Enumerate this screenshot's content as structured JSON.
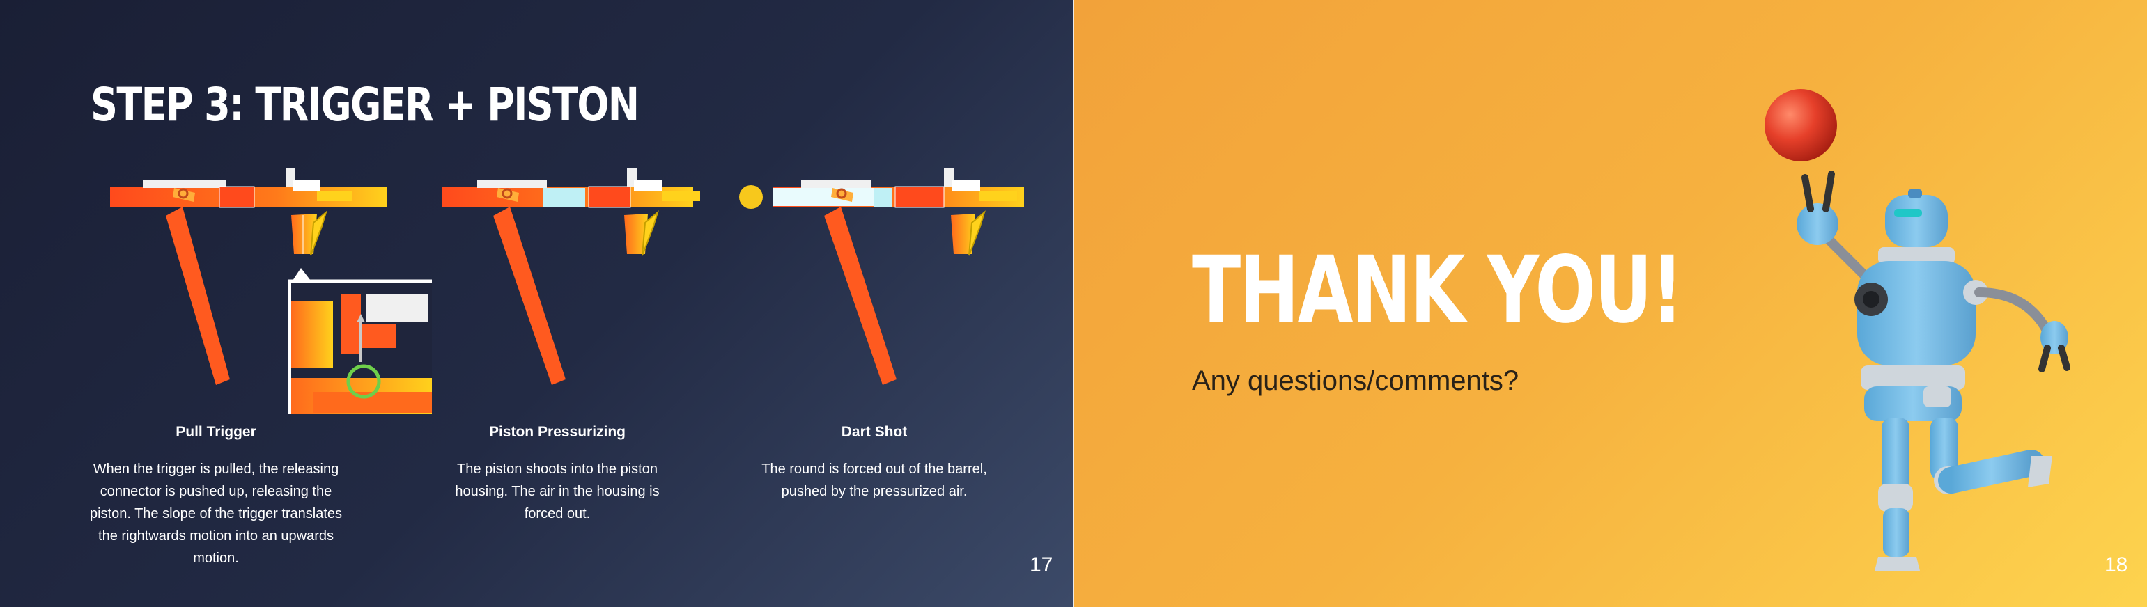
{
  "slides": [
    {
      "title": "STEP 3: TRIGGER + PISTON",
      "steps": [
        {
          "label": "Pull Trigger",
          "description": "When the trigger is pulled, the releasing connector is pushed up, releasing the piston. The slope of the trigger translates the rightwards motion into an upwards motion."
        },
        {
          "label": "Piston Pressurizing",
          "description": "The piston shoots into the piston housing. The air in the housing is forced out."
        },
        {
          "label": "Dart Shot",
          "description": "The round is forced out of the barrel, pushed by the pressurized air."
        }
      ],
      "page_number": "17"
    },
    {
      "title": "THANK YOU!",
      "subtitle": "Any questions/comments?",
      "page_number": "18"
    }
  ],
  "colors": {
    "accent_orange": "#ff5a1f",
    "accent_yellow": "#f7d21c",
    "slide_dark_bg": "#1f253c",
    "slide_orange_bg": "#f6b03f",
    "robot_blue": "#7bbfe6",
    "ball_red": "#e6402a"
  },
  "icons": [
    "mechanism-diagram",
    "zoom-inset",
    "robot-illustration",
    "ball-illustration"
  ]
}
